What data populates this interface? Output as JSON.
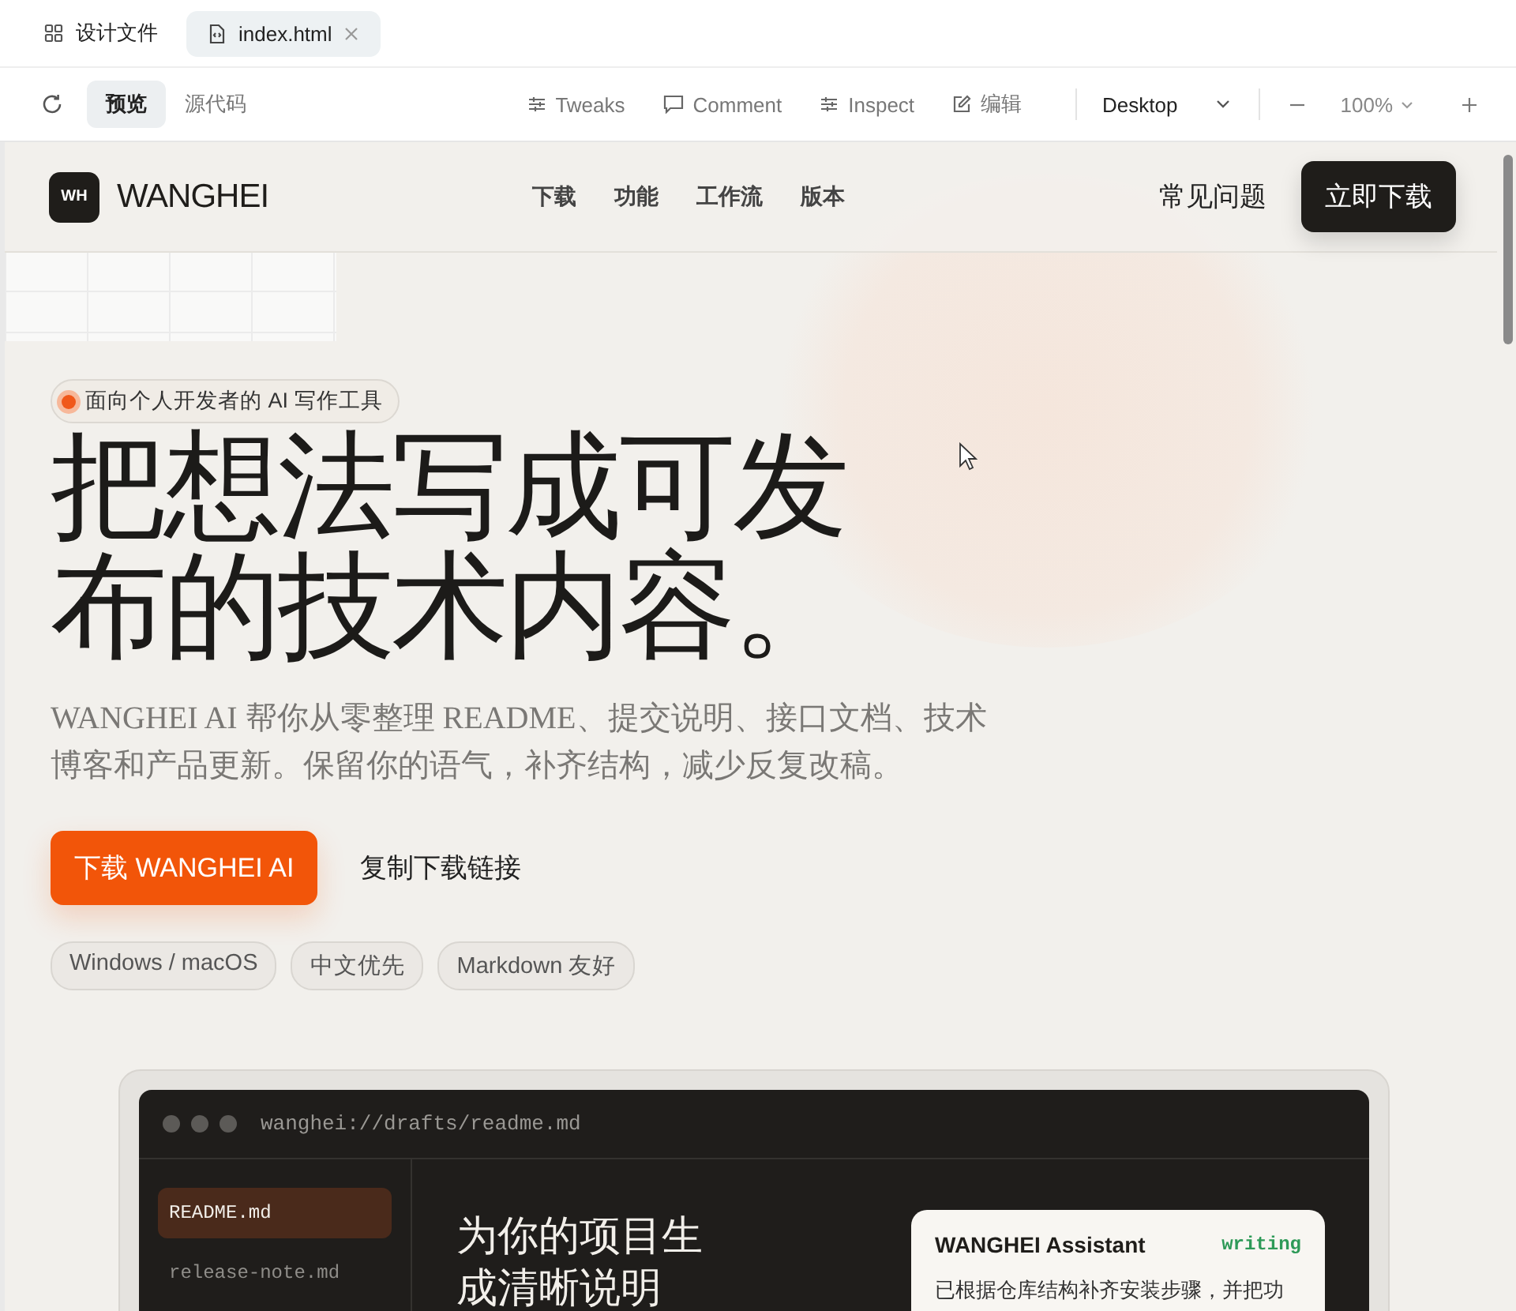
{
  "file_tabs": [
    {
      "label": "设计文件",
      "selected": false,
      "kind": "grid",
      "closable": false
    },
    {
      "label": "index.html",
      "selected": true,
      "kind": "file",
      "closable": true
    }
  ],
  "toolbar": {
    "view_tabs": [
      {
        "label": "预览",
        "selected": true
      },
      {
        "label": "源代码",
        "selected": false
      }
    ],
    "tools": [
      {
        "label": "Tweaks",
        "kind": "sliders"
      },
      {
        "label": "Comment",
        "kind": "comment"
      },
      {
        "label": "Inspect",
        "kind": "sliders"
      },
      {
        "label": "编辑",
        "kind": "edit"
      }
    ],
    "device": "Desktop",
    "zoom": "100%"
  },
  "site": {
    "logo_mark": "WH",
    "brand": "WANGHEI",
    "nav": [
      "下载",
      "功能",
      "工作流",
      "版本"
    ],
    "faq": "常见问题",
    "cta": "立即下载"
  },
  "hero": {
    "badge": "面向个人开发者的 AI 写作工具",
    "title_lines": [
      "把想法写成可发",
      "布的技术内容。"
    ],
    "description": "WANGHEI AI 帮你从零整理 README、提交说明、接口文档、技术博客和产品更新。保留你的语气，补齐结构，减少反复改稿。",
    "primary_button": "下载 WANGHEI AI",
    "secondary_button": "复制下载链接",
    "tags": [
      "Windows / macOS",
      "中文优先",
      "Markdown 友好"
    ]
  },
  "preview": {
    "path": "wanghei://drafts/readme.md",
    "files": [
      {
        "name": "README.md",
        "selected": true
      },
      {
        "name": "release-note.md",
        "selected": false
      }
    ],
    "heading_lines": [
      "为你的项目生",
      "成清晰说明"
    ],
    "assistant": {
      "title": "WANGHEI Assistant",
      "status": "writing",
      "message": "已根据仓库结构补齐安装步骤，并把功"
    }
  }
}
